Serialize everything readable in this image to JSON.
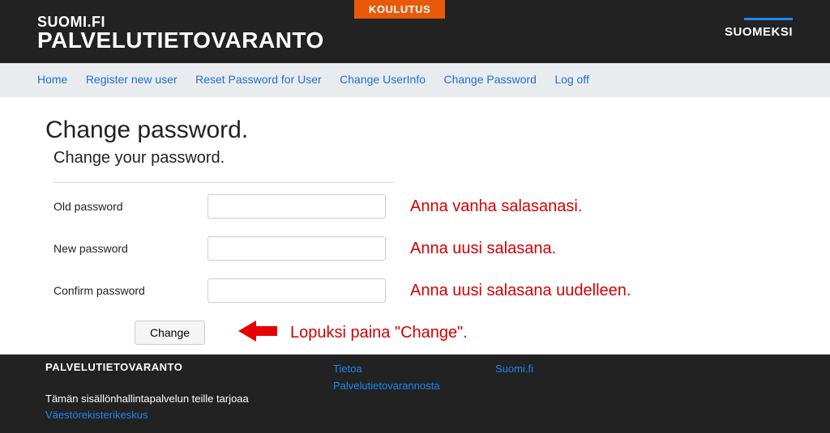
{
  "topbar": {
    "koulutus": "KOULUTUS",
    "brand_small": "SUOMI.FI",
    "brand_big": "PALVELUTIETOVARANTO",
    "lang": "SUOMEKSI"
  },
  "nav": {
    "home": "Home",
    "register": "Register new user",
    "reset": "Reset Password for User",
    "userinfo": "Change UserInfo",
    "changepw": "Change Password",
    "logoff": "Log off"
  },
  "page": {
    "title": "Change password.",
    "subtitle": "Change your password.",
    "labels": {
      "old": "Old password",
      "new": "New password",
      "confirm": "Confirm password"
    },
    "hints": {
      "old": "Anna vanha salasanasi.",
      "new": "Anna uusi salasana.",
      "confirm": "Anna uusi salasana uudelleen.",
      "button": "Lopuksi paina \"Change\"."
    },
    "button": "Change"
  },
  "footer": {
    "brand": "PALVELUTIETOVARANTO",
    "desc_prefix": "Tämän sisällönhallintapalvelun teille tarjoaa ",
    "desc_link": "Väestörekisterikeskus",
    "col2a": "Tietoa",
    "col2b": "Palvelutietovarannosta",
    "col3a": "Suomi.fi"
  }
}
